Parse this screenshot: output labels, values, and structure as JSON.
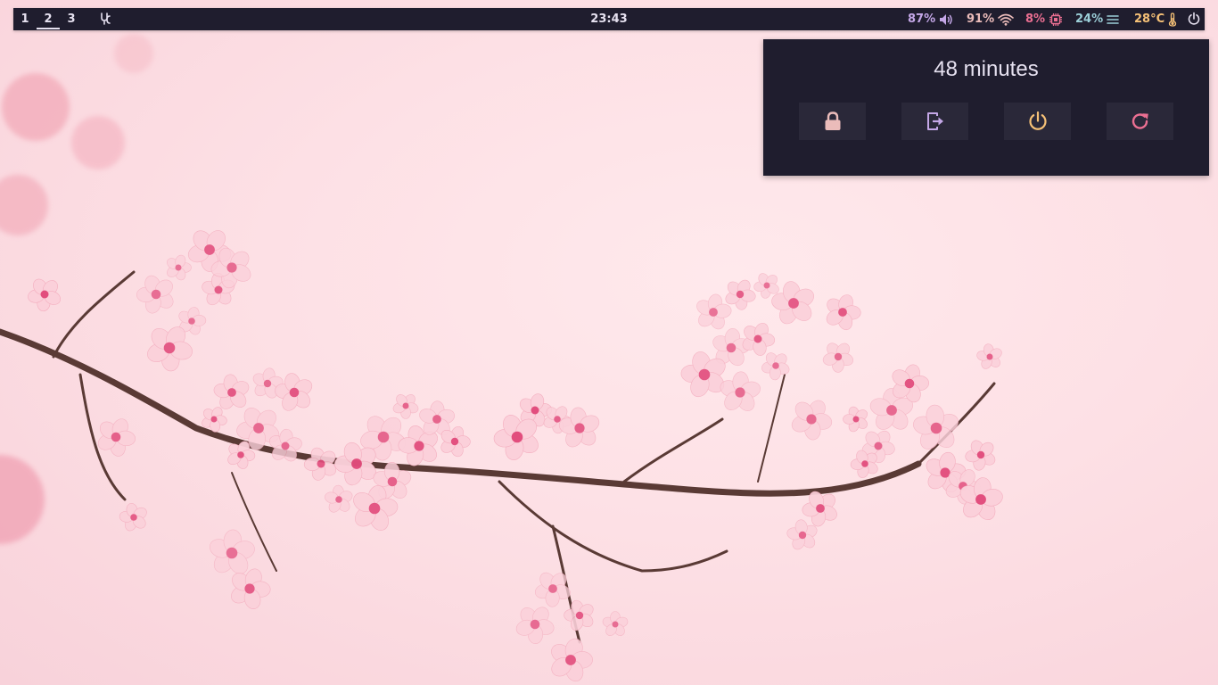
{
  "topbar": {
    "workspaces": [
      "1",
      "2",
      "3"
    ],
    "active_workspace": "2",
    "clock": "23:43",
    "modules": {
      "volume": {
        "value": "87%",
        "icon": "volume-icon",
        "color": "#c4a7e7"
      },
      "wifi": {
        "value": "91%",
        "icon": "wifi-icon",
        "color": "#ebbcba"
      },
      "cpu": {
        "value": "8%",
        "icon": "cpu-icon",
        "color": "#eb6f92"
      },
      "memory": {
        "value": "24%",
        "icon": "memory-icon",
        "color": "#9ccfd8"
      },
      "temperature": {
        "value": "28°C",
        "icon": "thermometer-icon",
        "color": "#f6c177"
      }
    },
    "power_icon": "power-icon"
  },
  "session_menu": {
    "uptime": "48 minutes",
    "buttons": [
      {
        "name": "lock",
        "icon": "lock-icon",
        "color": "#ebbcba"
      },
      {
        "name": "logout",
        "icon": "logout-icon",
        "color": "#c4a7e7"
      },
      {
        "name": "shutdown",
        "icon": "power-icon",
        "color": "#f6c177"
      },
      {
        "name": "reboot",
        "icon": "reboot-icon",
        "color": "#eb6f92"
      }
    ]
  },
  "wallpaper": {
    "subject": "cherry-blossom-branch",
    "background_color": "#fde0e5"
  }
}
